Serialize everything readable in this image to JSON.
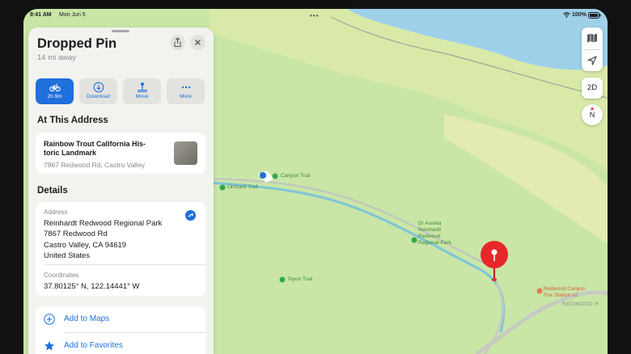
{
  "status_bar": {
    "time": "9:41 AM",
    "date": "Mon Jun 5",
    "battery": "100%"
  },
  "panel": {
    "title": "Dropped Pin",
    "subtitle": "14 mi away",
    "actions": [
      {
        "label": "2h 9m",
        "icon": "bicycle-icon"
      },
      {
        "label": "Download",
        "icon": "download-icon"
      },
      {
        "label": "Move",
        "icon": "move-icon"
      },
      {
        "label": "More",
        "icon": "more-icon"
      }
    ],
    "at_address": {
      "heading": "At This Address",
      "place_name_line1": "Rainbow Trout California His-",
      "place_name_line2": "toric Landmark",
      "place_address": "7867 Redwood Rd, Castro Valley"
    },
    "details": {
      "heading": "Details",
      "address_label": "Address",
      "address_lines": [
        "Reinhardt Redwood Regional Park",
        "7867 Redwood Rd",
        "Castro Valley, CA  94619",
        "United States"
      ],
      "coordinates_label": "Coordinates",
      "coordinates": "37.80125° N, 122.14441° W"
    },
    "list": [
      {
        "label": "Add to Maps",
        "icon": "plus-icon"
      },
      {
        "label": "Add to Favorites",
        "icon": "star-icon"
      }
    ]
  },
  "map_controls": {
    "view_mode": "2D",
    "compass": "N"
  },
  "map_labels": {
    "canyon_trail": "Canyon Trail",
    "orchard_trail": "Orchard Trail",
    "aurelia_1": "Dr Aurelia",
    "aurelia_2": "Reinhardt",
    "aurelia_3": "Redwood",
    "aurelia_4": "Regional Park",
    "toyon_trail": "Toyon Trail",
    "fire_1": "Redwood Canyon",
    "fire_2": "Fire Station #2",
    "road": "REDWOOD R"
  },
  "colors": {
    "accent": "#1f6fdc",
    "pin": "#e8272b",
    "water": "#9fd0ea",
    "terrain": "#c9e6a6"
  }
}
